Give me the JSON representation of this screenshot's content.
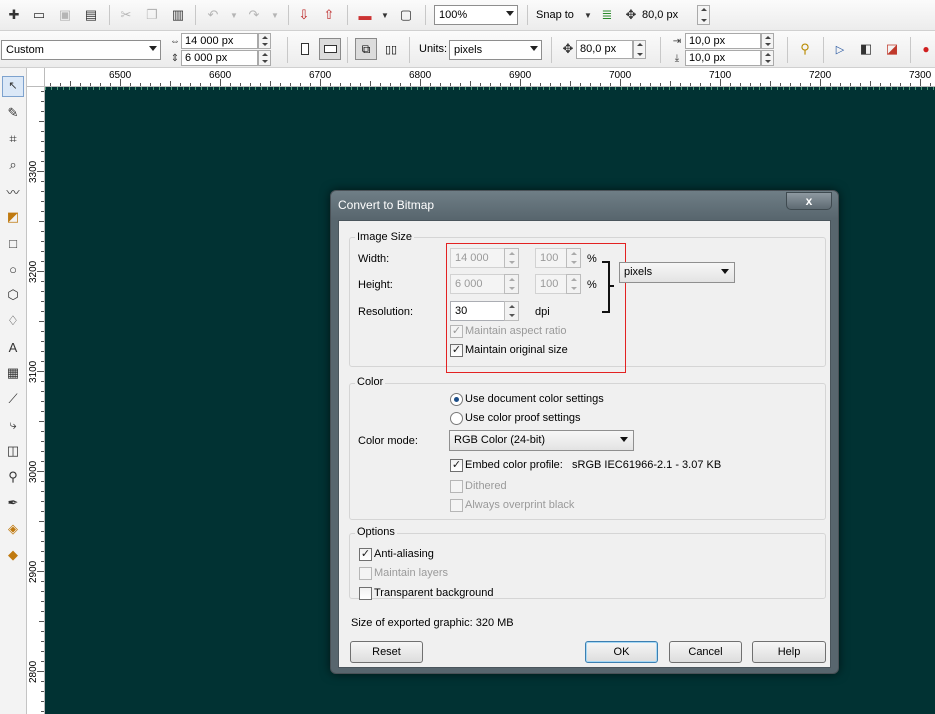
{
  "toolbar1": {
    "icons": [
      "new-icon",
      "open-icon",
      "save-icon",
      "print-icon",
      "cut-icon",
      "copy-icon",
      "paste-icon",
      "undo-icon",
      "redo-icon",
      "import-icon",
      "export-icon",
      "application-launcher-icon",
      "welcome-screen-icon"
    ],
    "zoom": "100%",
    "snap_to": "Snap to",
    "nudge_distance": "80,0 px"
  },
  "toolbar2": {
    "page_preset": "Custom",
    "page_width": "14 000 px",
    "page_height": "6 000 px",
    "units_label": "Units:",
    "units_value": "pixels",
    "nudge": "80,0 px",
    "duplicate_x": "10,0 px",
    "duplicate_y": "10,0 px"
  },
  "ruler": {
    "h_labels": [
      "6500",
      "6600",
      "6700",
      "6800",
      "6900",
      "7000",
      "7100",
      "7200",
      "7300"
    ],
    "v_labels": [
      "3300",
      "3200",
      "3100",
      "3000",
      "2900",
      "2800"
    ]
  },
  "toolbox": {
    "tools": [
      "pick-tool-icon",
      "shape-tool-icon",
      "crop-tool-icon",
      "zoom-tool-icon",
      "freehand-tool-icon",
      "smart-fill-icon",
      "rectangle-tool-icon",
      "ellipse-tool-icon",
      "polygon-tool-icon",
      "basic-shapes-icon",
      "text-tool-icon",
      "table-tool-icon",
      "parallel-dimension-icon",
      "connector-tool-icon",
      "blend-tool-icon",
      "eyedropper-tool-icon",
      "outline-tool-icon",
      "fill-tool-icon",
      "interactive-fill-icon"
    ]
  },
  "dialog": {
    "title": "Convert to Bitmap",
    "close": "x",
    "image_size": {
      "group_label": "Image Size",
      "width_label": "Width:",
      "width_value": "14 000",
      "width_percent": "100",
      "height_label": "Height:",
      "height_value": "6 000",
      "height_percent": "100",
      "percent_sign": "%",
      "units_value": "pixels",
      "resolution_label": "Resolution:",
      "resolution_value": "30",
      "resolution_unit": "dpi",
      "maintain_aspect": "Maintain aspect ratio",
      "maintain_original": "Maintain original size"
    },
    "color": {
      "group_label": "Color",
      "use_document": "Use document color settings",
      "use_proof": "Use color proof settings",
      "mode_label": "Color mode:",
      "mode_value": "RGB Color (24-bit)",
      "embed_profile": "Embed color profile:",
      "profile_name": "sRGB IEC61966-2.1 - 3.07 KB",
      "dithered": "Dithered",
      "overprint": "Always overprint black"
    },
    "options": {
      "group_label": "Options",
      "anti_aliasing": "Anti-aliasing",
      "maintain_layers": "Maintain layers",
      "transparent_bg": "Transparent background"
    },
    "size_text": "Size of exported graphic: 320 MB",
    "buttons": {
      "reset": "Reset",
      "ok": "OK",
      "cancel": "Cancel",
      "help": "Help"
    },
    "check_mark": "✓"
  }
}
